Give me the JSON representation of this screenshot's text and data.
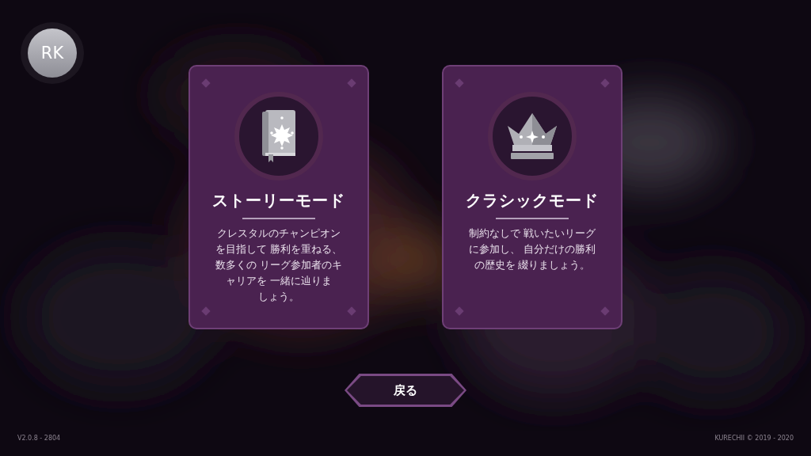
{
  "avatar": {
    "initials": "RK"
  },
  "modes": [
    {
      "kind": "book",
      "title": "ストーリーモード",
      "lines": [
        "クレスタルのチャンピオン",
        "を目指して 勝利を重ねる、",
        "数多くの リーグ参加者のキ",
        "ャリアを 一緒に辿りま",
        "しょう。"
      ]
    },
    {
      "kind": "crown",
      "title": "クラシックモード",
      "lines": [
        "制約なしで 戦いたいリーグ",
        "に参加し、 自分だけの勝利",
        "の歴史を 綴りましょう。"
      ]
    }
  ],
  "back_button": {
    "label": "戻る"
  },
  "version": "V2.0.8 - 2804",
  "copyright": "KURECHII © 2019 - 2020"
}
